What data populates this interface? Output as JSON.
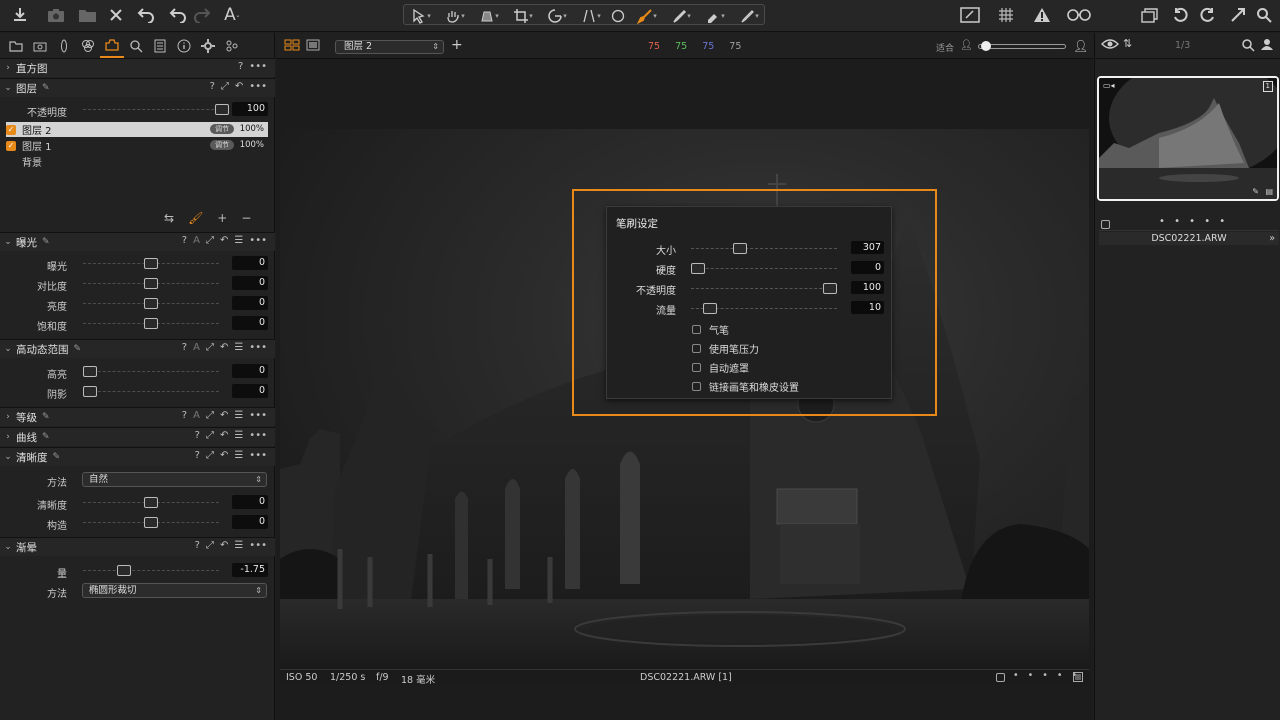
{
  "toolbar": {
    "left_icons": [
      "import-icon",
      "camera-icon",
      "folder-export-icon",
      "close-icon",
      "undo-icon",
      "undo-icon-2",
      "redo-icon",
      "text-icon"
    ],
    "tools": [
      "select-tool",
      "pan-tool",
      "loupe-tool",
      "crop-tool",
      "rotate-tool",
      "keystone-tool",
      "spot-tool",
      "brush-tool",
      "picker-tool",
      "eraser-tool",
      "gradient-tool"
    ],
    "right_icons": [
      "edit-icon",
      "grid-icon",
      "warning-icon",
      "glasses-icon",
      "copy-icon",
      "rotate-left-icon",
      "rotate-right-icon",
      "expand-icon",
      "search-icon"
    ]
  },
  "left_panel": {
    "histogram": {
      "title": "直方图",
      "help": "?"
    },
    "layers": {
      "title": "图层",
      "opacity_label": "不透明度",
      "opacity_value": "100",
      "opacity_level": 1.0,
      "items": [
        {
          "name": "图层 2",
          "badge": "调节",
          "pct": "100%",
          "selected": true
        },
        {
          "name": "图层 1",
          "badge": "调节",
          "pct": "100%",
          "selected": false
        },
        {
          "name": "背景",
          "badge": "",
          "pct": "",
          "selected": false
        }
      ]
    },
    "exposure": {
      "title": "曝光",
      "rows": [
        {
          "label": "曝光",
          "value": "0",
          "level": 0.5
        },
        {
          "label": "对比度",
          "value": "0",
          "level": 0.5
        },
        {
          "label": "亮度",
          "value": "0",
          "level": 0.5
        },
        {
          "label": "饱和度",
          "value": "0",
          "level": 0.5
        }
      ]
    },
    "hdr": {
      "title": "高动态范围",
      "rows": [
        {
          "label": "高亮",
          "value": "0",
          "level": 0.0
        },
        {
          "label": "阴影",
          "value": "0",
          "level": 0.0
        }
      ]
    },
    "levels": {
      "title": "等级"
    },
    "curves": {
      "title": "曲线"
    },
    "clarity": {
      "title": "清晰度",
      "method_label": "方法",
      "method_value": "自然",
      "rows": [
        {
          "label": "清晰度",
          "value": "0",
          "level": 0.5
        },
        {
          "label": "构造",
          "value": "0",
          "level": 0.5
        }
      ]
    },
    "vignette": {
      "title": "渐晕",
      "amount_label": "量",
      "amount_value": "-1.75",
      "amount_level": 0.28,
      "method_label": "方法",
      "method_value": "椭圆形裁切"
    }
  },
  "viewer": {
    "layer_select": "图层 2",
    "channels": [
      {
        "v": "75",
        "c": "#e0604e"
      },
      {
        "v": "75",
        "c": "#5cbd5c"
      },
      {
        "v": "75",
        "c": "#6b75d8"
      },
      {
        "v": "75",
        "c": "#a0a0a0"
      }
    ],
    "fit_label": "适合",
    "status": {
      "iso": "ISO 50",
      "shutter": "1/250 s",
      "aperture": "f/9",
      "focal": "18 毫米",
      "filename": "DSC02221.ARW [1]"
    }
  },
  "brush_popup": {
    "title": "笔刷设定",
    "sliders": [
      {
        "label": "大小",
        "value": "307",
        "level": 0.32
      },
      {
        "label": "硬度",
        "value": "0",
        "level": 0.0
      },
      {
        "label": "不透明度",
        "value": "100",
        "level": 1.0
      },
      {
        "label": "流量",
        "value": "10",
        "level": 0.09
      }
    ],
    "checkboxes": [
      "气笔",
      "使用笔压力",
      "自动遮罩",
      "链接画笔和橡皮设置"
    ]
  },
  "right_panel": {
    "counter": "1/3",
    "thumb_badge": "1",
    "filename": "DSC02221.ARW",
    "dots": "• • • • •"
  }
}
